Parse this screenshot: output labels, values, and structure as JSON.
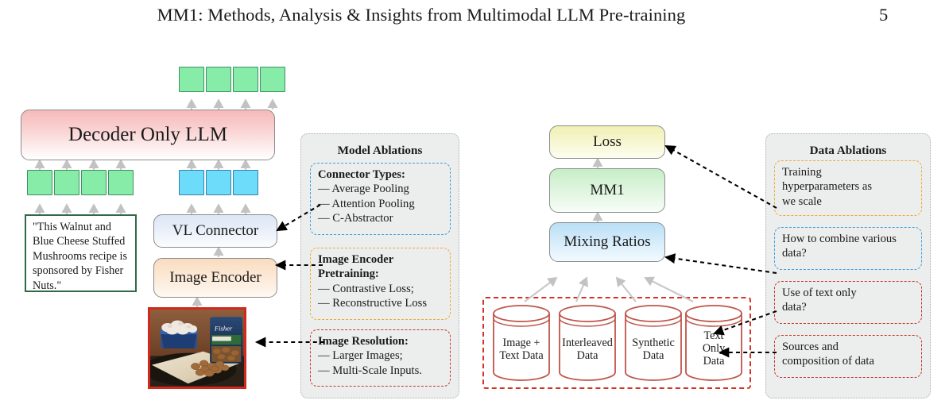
{
  "header": {
    "title": "MM1: Methods, Analysis & Insights from Multimodal LLM Pre-training",
    "page_number": "5"
  },
  "architecture": {
    "llm": "Decoder Only LLM",
    "vl_connector": "VL Connector",
    "image_encoder": "Image Encoder",
    "caption": "\"This Walnut and Blue Cheese Stuffed Mushrooms recipe is sponsored by Fisher Nuts.\"",
    "caption_lines": [
      "\"This Walnut and",
      "Blue Cheese Stuffed",
      "Mushrooms recipe is",
      "sponsored by Fisher",
      "Nuts.\""
    ],
    "photo_alt": "Mushrooms in a blue baking dish next to a Fisher walnuts bag on a wooden cutting board",
    "output_token_count": 4,
    "text_token_count": 4,
    "image_token_count": 3
  },
  "training": {
    "loss": "Loss",
    "model": "MM1",
    "mixing_ratios": "Mixing Ratios",
    "data_sources": [
      {
        "lines": [
          "Image +",
          "Text Data"
        ]
      },
      {
        "lines": [
          "Interleaved",
          "Data"
        ]
      },
      {
        "lines": [
          "Synthetic",
          "Data"
        ]
      },
      {
        "lines": [
          "Text",
          "Only",
          "Data"
        ]
      }
    ]
  },
  "model_ablations": {
    "title": "Model Ablations",
    "cards": [
      {
        "accent": "#3f9ee0",
        "heading": "Connector Types:",
        "items": [
          "— Average Pooling",
          "— Attention Pooling",
          "— C-Abstractor"
        ]
      },
      {
        "accent": "#eeaa33",
        "heading": "Image Encoder",
        "heading2": "Pretraining:",
        "items": [
          "— Contrastive Loss;",
          "— Reconstructive Loss"
        ]
      },
      {
        "accent": "#c3372a",
        "heading": "Image Resolution:",
        "items": [
          "— Larger Images;",
          "— Multi-Scale Inputs."
        ]
      }
    ]
  },
  "data_ablations": {
    "title": "Data Ablations",
    "cards": [
      {
        "accent": "#eeaa33",
        "items": [
          "Training",
          "hyperparameters as",
          "we scale"
        ]
      },
      {
        "accent": "#3f9ee0",
        "items": [
          "How to combine various",
          "data?"
        ]
      },
      {
        "accent": "#c3372a",
        "items": [
          "Use of text only",
          "data?"
        ]
      },
      {
        "accent": "#c3372a",
        "items": [
          "Sources and",
          "composition of data"
        ]
      }
    ]
  },
  "colors": {
    "token_green": "#86eca8",
    "token_blue": "#6ddcfb",
    "llm_pink": "#f6b9b9",
    "encoder_orange": "#fadcc0",
    "connector_blue": "#dde6f6",
    "loss_yellow": "#f0f0b4",
    "mm1_green": "#c6eec6",
    "mixing_blue": "#b9dff6",
    "cylinder_red": "#c0544a",
    "photo_border": "#d12a1c",
    "quote_border": "#2e6b45",
    "panel_bg": "#eceeed",
    "arrow_grey": "#c9c9c9",
    "arrow_black": "#000000"
  }
}
